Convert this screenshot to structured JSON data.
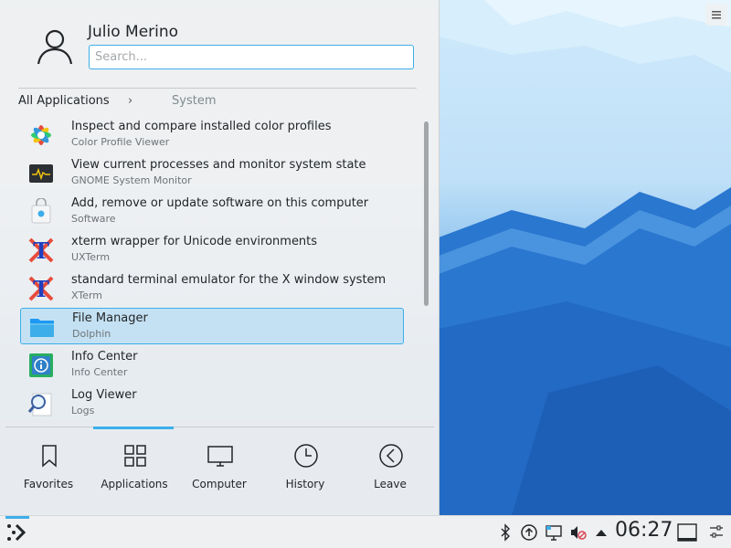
{
  "user": {
    "name": "Julio Merino"
  },
  "search": {
    "placeholder": "Search..."
  },
  "breadcrumb": {
    "root": "All Applications",
    "separator": "›",
    "current": "System"
  },
  "apps": [
    {
      "title": "Inspect and compare installed color profiles",
      "name": "Color Profile Viewer",
      "icon": "color-profile-icon"
    },
    {
      "title": "View current processes and monitor system state",
      "name": "GNOME System Monitor",
      "icon": "system-monitor-icon"
    },
    {
      "title": "Add, remove or update software on this computer",
      "name": "Software",
      "icon": "software-store-icon"
    },
    {
      "title": "xterm wrapper for Unicode environments",
      "name": "UXTerm",
      "icon": "xterm-icon"
    },
    {
      "title": "standard terminal emulator for the X window system",
      "name": "XTerm",
      "icon": "xterm-icon"
    },
    {
      "title": "File Manager",
      "name": "Dolphin",
      "icon": "folder-icon",
      "selected": true
    },
    {
      "title": "Info Center",
      "name": "Info Center",
      "icon": "info-icon"
    },
    {
      "title": "Log Viewer",
      "name": "Logs",
      "icon": "log-viewer-icon"
    }
  ],
  "tabs": [
    {
      "label": "Favorites",
      "icon": "bookmark-icon"
    },
    {
      "label": "Applications",
      "icon": "grid-icon",
      "active": true
    },
    {
      "label": "Computer",
      "icon": "monitor-icon"
    },
    {
      "label": "History",
      "icon": "clock-icon"
    },
    {
      "label": "Leave",
      "icon": "back-circle-icon"
    }
  ],
  "panel": {
    "clock": "06:27",
    "tray_icons": [
      "bluetooth-icon",
      "update-icon",
      "network-icon",
      "volume-muted-icon",
      "expand-up-icon"
    ]
  },
  "colors": {
    "accent": "#3daee9",
    "selection": "#c4e1f3",
    "menu_bg": "#eff0f1"
  }
}
